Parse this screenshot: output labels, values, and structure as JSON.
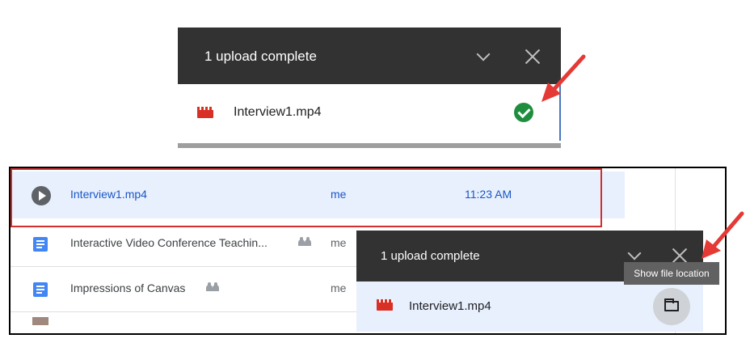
{
  "top_panel": {
    "title": "1 upload complete",
    "file": "Interview1.mp4",
    "status": "complete",
    "icons": [
      "chevron-down-icon",
      "close-icon",
      "video-file-icon",
      "check-circle-icon"
    ]
  },
  "file_list": {
    "rows": [
      {
        "name": "Interview1.mp4",
        "owner": "me",
        "modified": "11:23 AM",
        "icon": "play-video-icon",
        "selected": true
      },
      {
        "name": "Interactive Video Conference Teachin...",
        "owner": "me",
        "modified": "",
        "icon": "doc-icon",
        "shared": true
      },
      {
        "name": "Impressions of Canvas",
        "owner": "me",
        "modified": "",
        "icon": "doc-icon",
        "shared": true
      },
      {
        "name": "",
        "owner": "",
        "modified": "",
        "icon": "image-thumbnail-icon"
      }
    ]
  },
  "bottom_panel": {
    "title": "1 upload complete",
    "file": "Interview1.mp4",
    "tooltip": "Show file location",
    "icons": [
      "chevron-down-icon",
      "close-icon",
      "video-file-icon",
      "folder-icon"
    ]
  },
  "colors": {
    "panel_header": "#323232",
    "selected_row": "#e8f0fe",
    "highlight_box": "#d32f2f",
    "arrow": "#e53935",
    "success": "#1e8e3e",
    "doc_blue": "#4285f4"
  }
}
